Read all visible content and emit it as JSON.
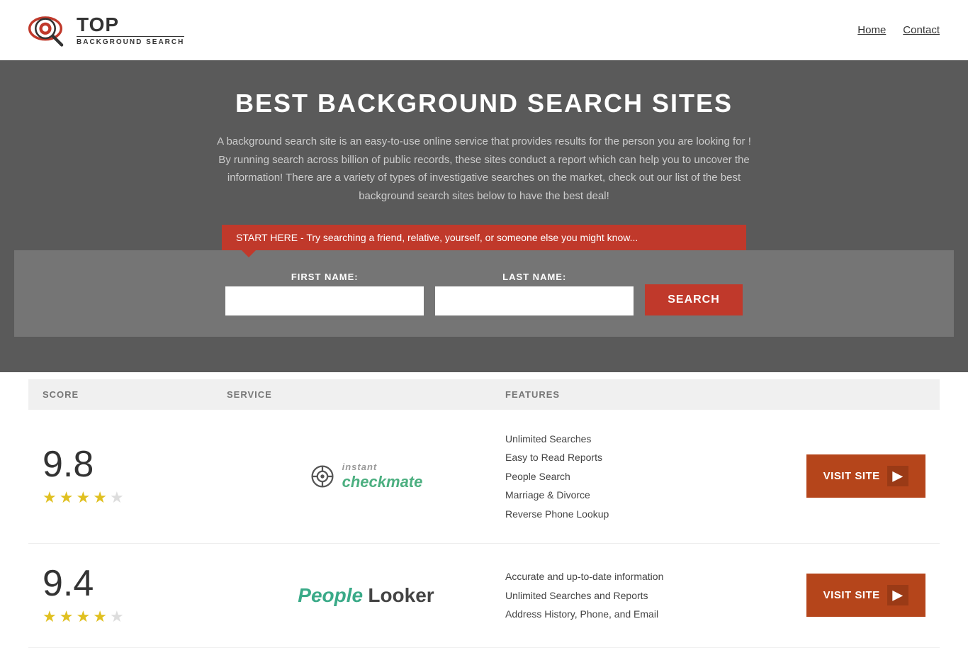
{
  "header": {
    "logo_top": "TOP",
    "logo_sub": "BACKGROUND SEARCH",
    "nav": {
      "home": "Home",
      "contact": "Contact"
    }
  },
  "hero": {
    "title": "BEST BACKGROUND SEARCH SITES",
    "description": "A background search site is an easy-to-use online service that provides results  for the person you are looking for ! By  running  search across billion of public records, these sites conduct  a report which can help you to uncover the information! There are a variety of types of investigative searches on the market, check out our  list of the best background search sites below to have the best deal!",
    "banner_text": "START HERE - Try searching a friend, relative, yourself, or someone else you might know...",
    "first_name_label": "FIRST NAME:",
    "last_name_label": "LAST NAME:",
    "search_button": "SEARCH"
  },
  "table": {
    "headers": {
      "score": "SCORE",
      "service": "SERVICE",
      "features": "FEATURES"
    },
    "rows": [
      {
        "score": "9.8",
        "stars": 4.5,
        "service_name": "Instant Checkmate",
        "service_type": "checkmate",
        "features": [
          "Unlimited Searches",
          "Easy to Read Reports",
          "People Search",
          "Marriage & Divorce",
          "Reverse Phone Lookup"
        ],
        "visit_label": "VISIT SITE"
      },
      {
        "score": "9.4",
        "stars": 4.0,
        "service_name": "PeopleLooker",
        "service_type": "peoplelooker",
        "features": [
          "Accurate and up-to-date information",
          "Unlimited Searches and Reports",
          "Address History, Phone, and Email"
        ],
        "visit_label": "VISIT SITE"
      }
    ]
  }
}
